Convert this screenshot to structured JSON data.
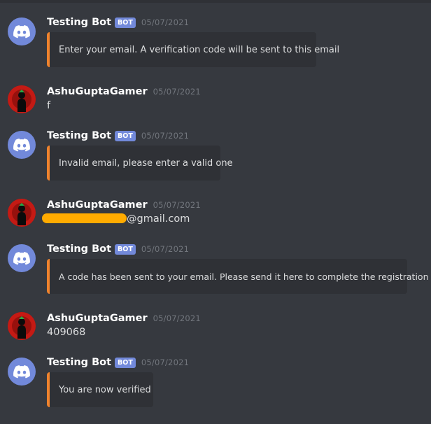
{
  "messages": [
    {
      "author": "Testing Bot",
      "badge": "BOT",
      "time": "05/07/2021",
      "embed": "Enter your email. A verification code will be sent to this email"
    },
    {
      "author": "AshuGuptaGamer",
      "time": "05/07/2021",
      "text": "f"
    },
    {
      "author": "Testing Bot",
      "badge": "BOT",
      "time": "05/07/2021",
      "embed": "Invalid email, please enter a valid one"
    },
    {
      "author": "AshuGuptaGamer",
      "time": "05/07/2021",
      "text": "@gmail.com"
    },
    {
      "author": "Testing Bot",
      "badge": "BOT",
      "time": "05/07/2021",
      "embed": "A code has been sent to your email. Please send it here to complete the registration"
    },
    {
      "author": "AshuGuptaGamer",
      "time": "05/07/2021",
      "text": "409068"
    },
    {
      "author": "Testing Bot",
      "badge": "BOT",
      "time": "05/07/2021",
      "embed": "You are now verified"
    }
  ],
  "colors": {
    "background": "#36393f",
    "embed_background": "#2f3136",
    "embed_accent": "#f0832d",
    "bot_badge": "#7289da",
    "bot_avatar": "#7289da",
    "user_avatar": "#b3130f",
    "redaction": "#ffab00"
  },
  "icons": {
    "bot_avatar": "discord-logo-icon",
    "user_avatar": "user-avatar-icon"
  }
}
